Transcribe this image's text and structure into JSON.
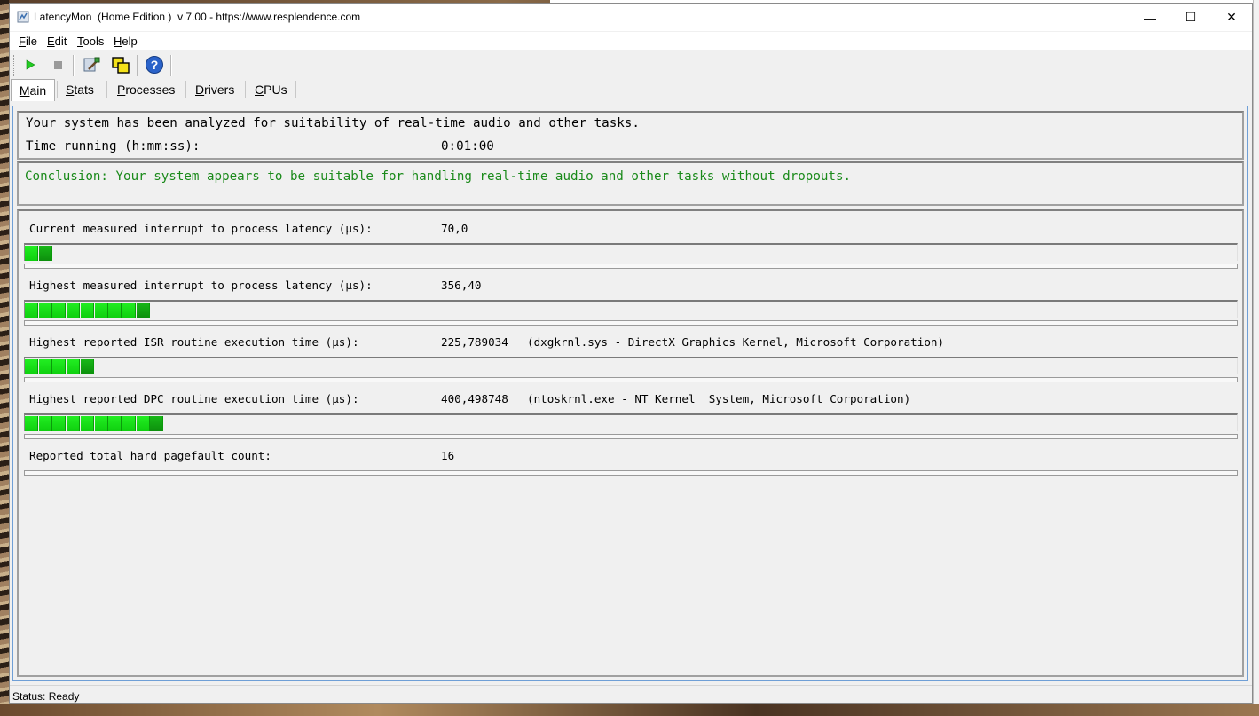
{
  "window": {
    "title": "LatencyMon  (Home Edition )  v 7.00 - https://www.resplendence.com",
    "minimize": "—",
    "maximize": "☐",
    "close": "✕"
  },
  "menu": [
    {
      "label": "File",
      "key": "F",
      "rest": "ile"
    },
    {
      "label": "Edit",
      "key": "E",
      "rest": "dit"
    },
    {
      "label": "Tools",
      "key": "T",
      "rest": "ools"
    },
    {
      "label": "Help",
      "key": "H",
      "rest": "elp"
    }
  ],
  "toolbar": {
    "icons": [
      "play-icon",
      "stop-icon",
      "tools-icon",
      "windows-icon",
      "help-icon"
    ],
    "colors": {
      "play": "#22cc22",
      "stop": "#9a9a9a",
      "help": "#2a62c9"
    }
  },
  "tabs": [
    {
      "label": "Main",
      "key": "M",
      "rest": "ain",
      "active": true
    },
    {
      "label": "Stats",
      "key": "S",
      "rest": "tats",
      "active": false
    },
    {
      "label": "Processes",
      "key": "P",
      "rest": "rocesses",
      "active": false
    },
    {
      "label": "Drivers",
      "key": "D",
      "rest": "rivers",
      "active": false
    },
    {
      "label": "CPUs",
      "key": "C",
      "rest": "PUs",
      "active": false
    }
  ],
  "summary": {
    "analyzed_text": "Your system has been analyzed for suitability of real-time audio and other tasks.",
    "time_running_label": "Time running (h:mm:ss):",
    "time_running_value": "0:01:00"
  },
  "conclusion": {
    "text": "Conclusion: Your system appears to be suitable for handling real-time audio and other tasks without dropouts.",
    "color": "#1a8a1a"
  },
  "metrics": [
    {
      "label": "Current measured interrupt to process latency (µs):",
      "value": "70,0",
      "detail": "",
      "bar_segments": 2
    },
    {
      "label": "Highest measured interrupt to process latency (µs):",
      "value": "356,40",
      "detail": "",
      "bar_segments": 9
    },
    {
      "label": "Highest reported ISR routine execution time (µs):",
      "value": "225,789034",
      "detail": "(dxgkrnl.sys - DirectX Graphics Kernel, Microsoft Corporation)",
      "bar_segments": 5
    },
    {
      "label": "Highest reported DPC routine execution time (µs):",
      "value": "400,498748",
      "detail": "(ntoskrnl.exe - NT Kernel _System, Microsoft Corporation)",
      "bar_segments": 10
    },
    {
      "label": "Reported total hard pagefault count:",
      "value": "16",
      "detail": "",
      "bar_segments": 0
    }
  ],
  "status": {
    "text": "Status: Ready"
  }
}
